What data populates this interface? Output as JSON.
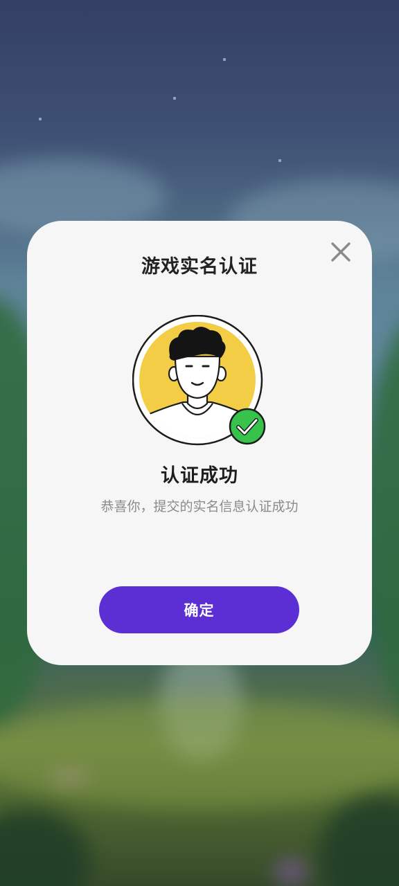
{
  "dialog": {
    "title": "游戏实名认证",
    "close_icon": "close-icon",
    "avatar_icon": "user-avatar-illustration",
    "badge_icon": "check-circle-icon",
    "result_title": "认证成功",
    "result_description": "恭喜你，提交的实名信息认证成功",
    "confirm_label": "确定"
  },
  "colors": {
    "dialog_background": "#f6f6f6",
    "primary_button": "#5b2fd3",
    "avatar_circle": "#f2cd45",
    "success_badge": "#37c24b",
    "title_text": "#222222",
    "description_text": "#8a8a8a"
  }
}
